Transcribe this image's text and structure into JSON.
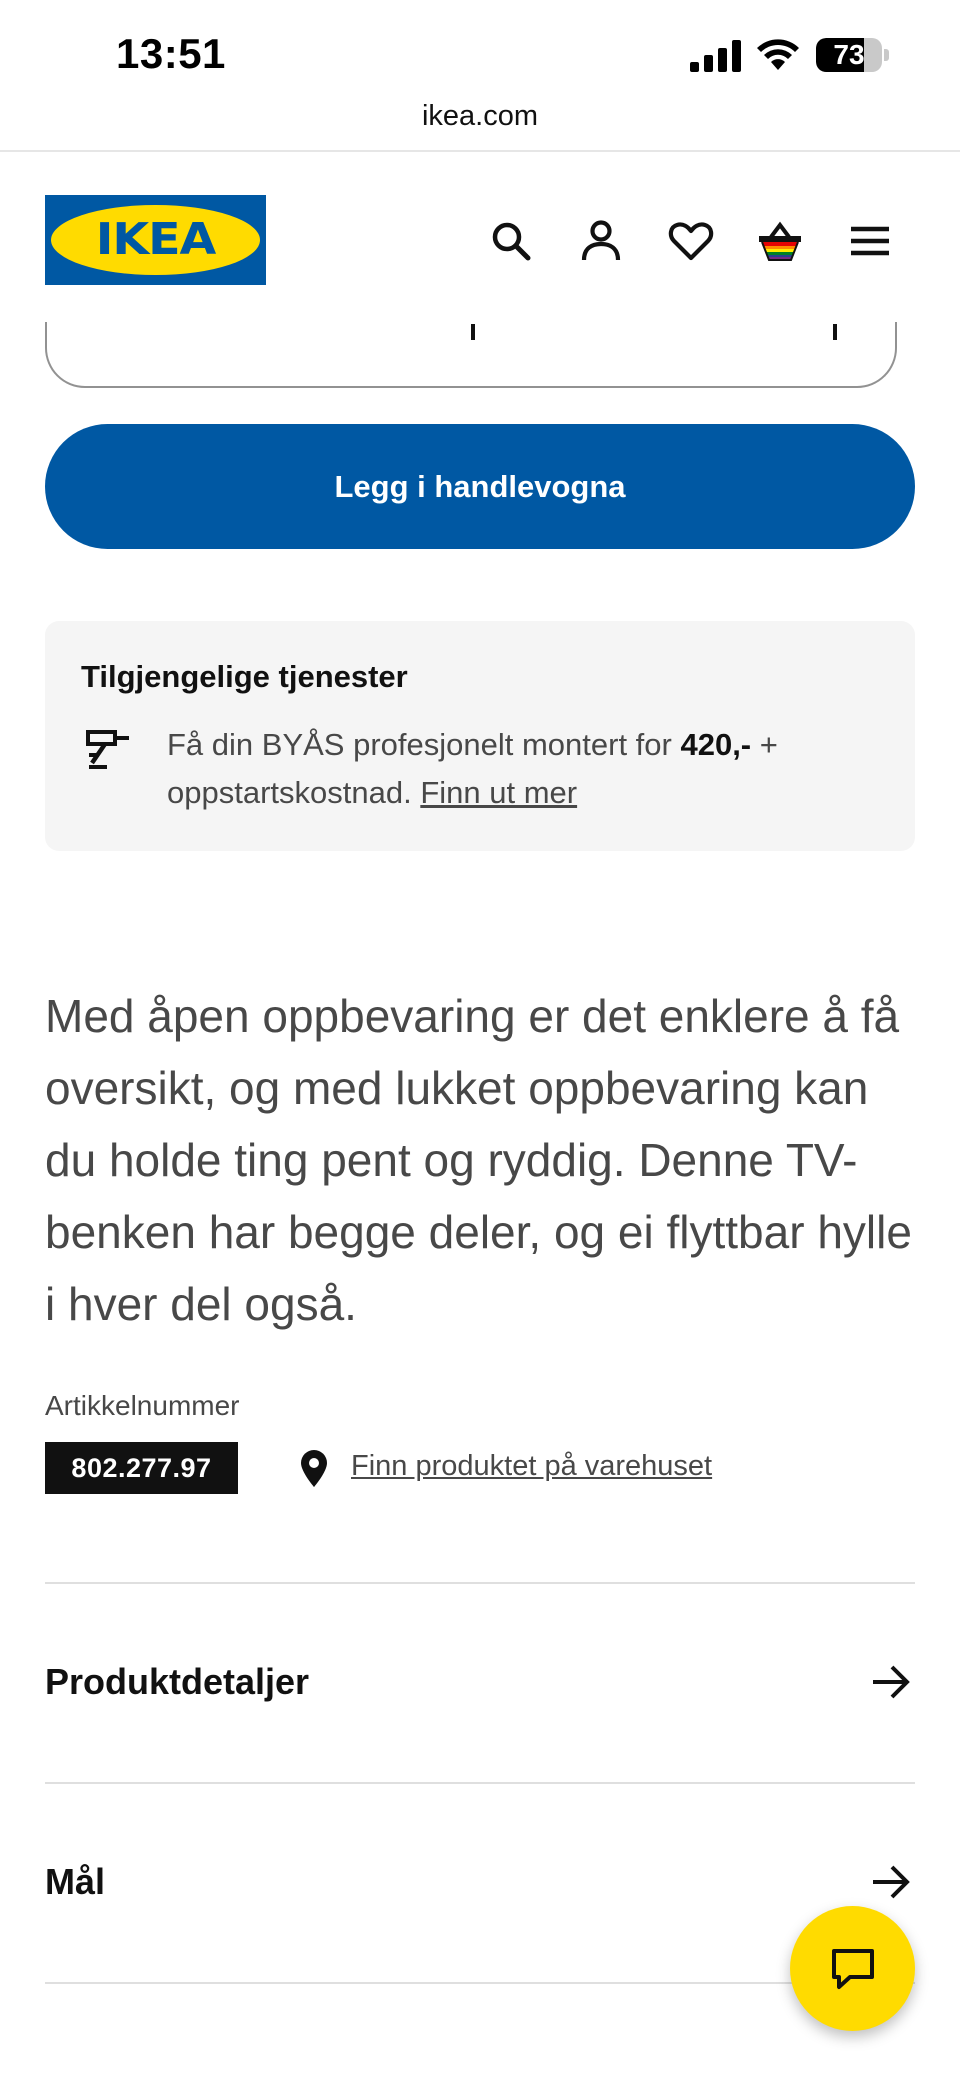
{
  "status_bar": {
    "time": "13:51",
    "battery_percent": "73",
    "battery_level": 0.73,
    "icons": [
      "signal-bars-icon",
      "wifi-icon",
      "battery-icon"
    ]
  },
  "browser": {
    "url": "ikea.com"
  },
  "header": {
    "logo_text": "IKEA",
    "icons": [
      "search-icon",
      "account-icon",
      "heart-icon",
      "basket-icon",
      "menu-icon"
    ],
    "brand_blue": "#0058a3",
    "brand_yellow": "#ffdb00"
  },
  "product": {
    "add_to_cart_label": "Legg i handlevogna",
    "services": {
      "title": "Tilgjengelige tjenester",
      "text_before": "Få din BYÅS profesjonelt montert for ",
      "price": "420,-",
      "text_after": " + oppstartskostnad. ",
      "link": "Finn ut mer"
    },
    "description": "Med åpen oppbevaring er det enklere å få oversikt, og med lukket oppbevaring kan du holde ting pent og ryddig. Denne TV-benken har begge deler, og ei flyttbar hylle i hver del også.",
    "article_label": "Artikkelnummer",
    "article_number": "802.277.97",
    "store_link": "Finn produktet på varehuset"
  },
  "accordion": [
    {
      "label": "Produktdetaljer"
    },
    {
      "label": "Mål"
    }
  ],
  "chat": {
    "icon": "chat-icon"
  }
}
